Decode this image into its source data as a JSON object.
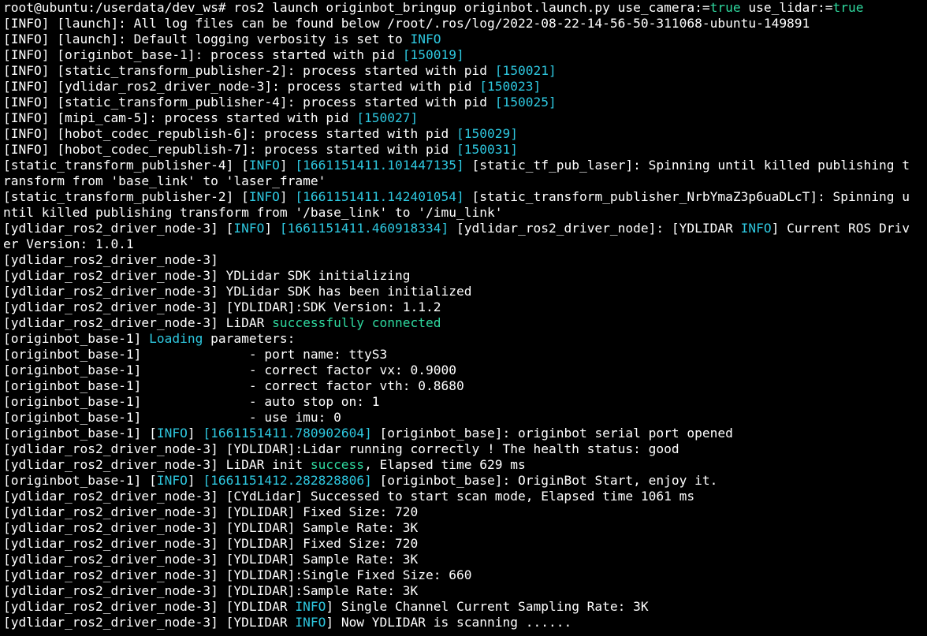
{
  "terminal": {
    "colors": {
      "background": "#000000",
      "foreground": "#ffffff",
      "cyan": "#2ec8e0",
      "green": "#2fd99f",
      "blue": "#2b8fd6"
    },
    "lines": [
      [
        {
          "t": "root@ubuntu:/userdata/dev_ws# ros2 launch originbot_bringup originbot.launch.py use_camera:=",
          "c": "white"
        },
        {
          "t": "true",
          "c": "green"
        },
        {
          "t": " use_lidar:=",
          "c": "white"
        },
        {
          "t": "true",
          "c": "green"
        }
      ],
      [
        {
          "t": "[INFO] [launch]: All log files can be found below /root/.ros/log/2022-08-22-14-56-50-311068-ubuntu-149891",
          "c": "white"
        }
      ],
      [
        {
          "t": "[INFO] [launch]: Default logging verbosity is set to ",
          "c": "white"
        },
        {
          "t": "INFO",
          "c": "cyan"
        }
      ],
      [
        {
          "t": "[INFO] [originbot_base-1]: process started with pid ",
          "c": "white"
        },
        {
          "t": "[150019]",
          "c": "cyan"
        }
      ],
      [
        {
          "t": "[INFO] [static_transform_publisher-2]: process started with pid ",
          "c": "white"
        },
        {
          "t": "[150021]",
          "c": "cyan"
        }
      ],
      [
        {
          "t": "[INFO] [ydlidar_ros2_driver_node-3]: process started with pid ",
          "c": "white"
        },
        {
          "t": "[150023]",
          "c": "cyan"
        }
      ],
      [
        {
          "t": "[INFO] [static_transform_publisher-4]: process started with pid ",
          "c": "white"
        },
        {
          "t": "[150025]",
          "c": "cyan"
        }
      ],
      [
        {
          "t": "[INFO] [mipi_cam-5]: process started with pid ",
          "c": "white"
        },
        {
          "t": "[150027]",
          "c": "cyan"
        }
      ],
      [
        {
          "t": "[INFO] [hobot_codec_republish-6]: process started with pid ",
          "c": "white"
        },
        {
          "t": "[150029]",
          "c": "cyan"
        }
      ],
      [
        {
          "t": "[INFO] [hobot_codec_republish-7]: process started with pid ",
          "c": "white"
        },
        {
          "t": "[150031]",
          "c": "cyan"
        }
      ],
      [
        {
          "t": "[static_transform_publisher-4] [",
          "c": "white"
        },
        {
          "t": "INFO",
          "c": "cyan"
        },
        {
          "t": "] ",
          "c": "white"
        },
        {
          "t": "[1661151411.101447135]",
          "c": "cyan"
        },
        {
          "t": " [static_tf_pub_laser]: Spinning until killed publishing t",
          "c": "white"
        }
      ],
      [
        {
          "t": "ransform from 'base_link' to 'laser_frame'",
          "c": "white"
        }
      ],
      [
        {
          "t": "[static_transform_publisher-2] [",
          "c": "white"
        },
        {
          "t": "INFO",
          "c": "cyan"
        },
        {
          "t": "] ",
          "c": "white"
        },
        {
          "t": "[1661151411.142401054]",
          "c": "cyan"
        },
        {
          "t": " [static_transform_publisher_NrbYmaZ3p6uaDLcT]: Spinning u",
          "c": "white"
        }
      ],
      [
        {
          "t": "ntil killed publishing transform from '/base_link' to '/imu_link'",
          "c": "white"
        }
      ],
      [
        {
          "t": "[ydlidar_ros2_driver_node-3] [",
          "c": "white"
        },
        {
          "t": "INFO",
          "c": "cyan"
        },
        {
          "t": "] ",
          "c": "white"
        },
        {
          "t": "[1661151411.460918334]",
          "c": "cyan"
        },
        {
          "t": " [ydlidar_ros2_driver_node]: [YDLIDAR ",
          "c": "white"
        },
        {
          "t": "INFO",
          "c": "cyan"
        },
        {
          "t": "] Current ROS Driv",
          "c": "white"
        }
      ],
      [
        {
          "t": "er Version: 1.0.1",
          "c": "white"
        }
      ],
      [
        {
          "t": "[ydlidar_ros2_driver_node-3]",
          "c": "white"
        }
      ],
      [
        {
          "t": "[ydlidar_ros2_driver_node-3] YDLidar SDK initializing",
          "c": "white"
        }
      ],
      [
        {
          "t": "[ydlidar_ros2_driver_node-3] YDLidar SDK has been initialized",
          "c": "white"
        }
      ],
      [
        {
          "t": "[ydlidar_ros2_driver_node-3] [YDLIDAR]:SDK Version: 1.1.2",
          "c": "white"
        }
      ],
      [
        {
          "t": "[ydlidar_ros2_driver_node-3] LiDAR ",
          "c": "white"
        },
        {
          "t": "successfully connected",
          "c": "green"
        }
      ],
      [
        {
          "t": "[originbot_base-1] ",
          "c": "white"
        },
        {
          "t": "Loading",
          "c": "cyan"
        },
        {
          "t": " parameters:",
          "c": "white"
        }
      ],
      [
        {
          "t": "[originbot_base-1]              - port name: ttyS3",
          "c": "white"
        }
      ],
      [
        {
          "t": "[originbot_base-1]              - correct factor vx: 0.9000",
          "c": "white"
        }
      ],
      [
        {
          "t": "[originbot_base-1]              - correct factor vth: 0.8680",
          "c": "white"
        }
      ],
      [
        {
          "t": "[originbot_base-1]              - auto stop on: 1",
          "c": "white"
        }
      ],
      [
        {
          "t": "[originbot_base-1]              - use imu: 0",
          "c": "white"
        }
      ],
      [
        {
          "t": "[originbot_base-1] [",
          "c": "white"
        },
        {
          "t": "INFO",
          "c": "cyan"
        },
        {
          "t": "] ",
          "c": "white"
        },
        {
          "t": "[1661151411.780902604]",
          "c": "cyan"
        },
        {
          "t": " [originbot_base]: originbot serial port opened",
          "c": "white"
        }
      ],
      [
        {
          "t": "[ydlidar_ros2_driver_node-3] [YDLIDAR]:Lidar running correctly ! The health status: good",
          "c": "white"
        }
      ],
      [
        {
          "t": "[ydlidar_ros2_driver_node-3] LiDAR init ",
          "c": "white"
        },
        {
          "t": "success",
          "c": "green"
        },
        {
          "t": ", Elapsed time 629 ms",
          "c": "white"
        }
      ],
      [
        {
          "t": "[originbot_base-1] [",
          "c": "white"
        },
        {
          "t": "INFO",
          "c": "cyan"
        },
        {
          "t": "] ",
          "c": "white"
        },
        {
          "t": "[1661151412.282828806]",
          "c": "cyan"
        },
        {
          "t": " [originbot_base]: OriginBot Start, enjoy it.",
          "c": "white"
        }
      ],
      [
        {
          "t": "[ydlidar_ros2_driver_node-3] [CYdLidar] Successed to start scan mode, Elapsed time 1061 ms",
          "c": "white"
        }
      ],
      [
        {
          "t": "[ydlidar_ros2_driver_node-3] [YDLIDAR] Fixed Size: 720",
          "c": "white"
        }
      ],
      [
        {
          "t": "[ydlidar_ros2_driver_node-3] [YDLIDAR] Sample Rate: 3K",
          "c": "white"
        }
      ],
      [
        {
          "t": "[ydlidar_ros2_driver_node-3] [YDLIDAR] Fixed Size: 720",
          "c": "white"
        }
      ],
      [
        {
          "t": "[ydlidar_ros2_driver_node-3] [YDLIDAR] Sample Rate: 3K",
          "c": "white"
        }
      ],
      [
        {
          "t": "[ydlidar_ros2_driver_node-3] [YDLIDAR]:Single Fixed Size: 660",
          "c": "white"
        }
      ],
      [
        {
          "t": "[ydlidar_ros2_driver_node-3] [YDLIDAR]:Sample Rate: 3K",
          "c": "white"
        }
      ],
      [
        {
          "t": "[ydlidar_ros2_driver_node-3] [YDLIDAR ",
          "c": "white"
        },
        {
          "t": "INFO",
          "c": "cyan"
        },
        {
          "t": "] Single Channel Current Sampling Rate: 3K",
          "c": "white"
        }
      ],
      [
        {
          "t": "[ydlidar_ros2_driver_node-3] [YDLIDAR ",
          "c": "white"
        },
        {
          "t": "INFO",
          "c": "cyan"
        },
        {
          "t": "] Now YDLIDAR is scanning ......",
          "c": "white"
        }
      ]
    ]
  }
}
